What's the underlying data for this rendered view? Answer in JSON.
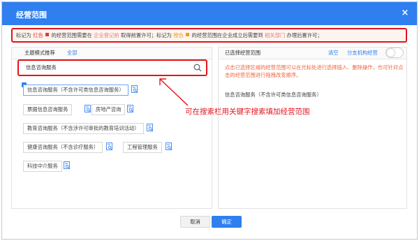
{
  "dialog": {
    "title": "经营范围",
    "close_label": "×"
  },
  "notice": {
    "p1": "标记为",
    "red_word": "红色",
    "p2": "的经营范围需要在",
    "registration_org": "企业登记前",
    "p3": "取得前置许可；标记为",
    "orange_word": "橙色",
    "p4": "的经营范围在企业成立后需要到",
    "dept": "相关部门",
    "p5": "办理后置许可；"
  },
  "left_panel": {
    "tab_theme": "主题模式推荐",
    "tab_all": "全部",
    "search": {
      "value": "信息咨询服务"
    },
    "chips": [
      {
        "label": "信息咨询服务（不含许可类信息咨询服务）",
        "checked": true
      },
      {
        "label": "票据信息咨询服务"
      },
      {
        "label": "房地产咨询"
      },
      {
        "label": "教育咨询服务（不含涉许可审批的教育培训活动）"
      },
      {
        "label": "健康咨询服务（不含诊疗服务）"
      },
      {
        "label": "工程管理服务"
      },
      {
        "label": "科技中介服务"
      }
    ]
  },
  "right_panel": {
    "title": "已选择经营范围",
    "clear": "清空",
    "branch": "分支机构经营",
    "hint": "点击已选择区域的经营范围可以在光标处进行选择插入、删除操作，也可针对点击的经营范围进行拖拽改变顺序。",
    "selected_items": [
      "信息咨询服务（不含许可类信息咨询服务）"
    ]
  },
  "annotation": "可在搜索栏用关键字搜索填加经营范围",
  "footer": {
    "cancel": "取消",
    "ok": "确定"
  },
  "colors": {
    "header": "#2f7ff0",
    "highlight_border": "#e1141c",
    "red_mark": "#e53935",
    "orange_mark": "#f29f1b",
    "hint_text": "#f0643c"
  },
  "icons": [
    "close-icon",
    "search-icon",
    "document-search-icon",
    "checkbox-checked-icon",
    "toggle-switch",
    "arrow-annotation-icon"
  ]
}
